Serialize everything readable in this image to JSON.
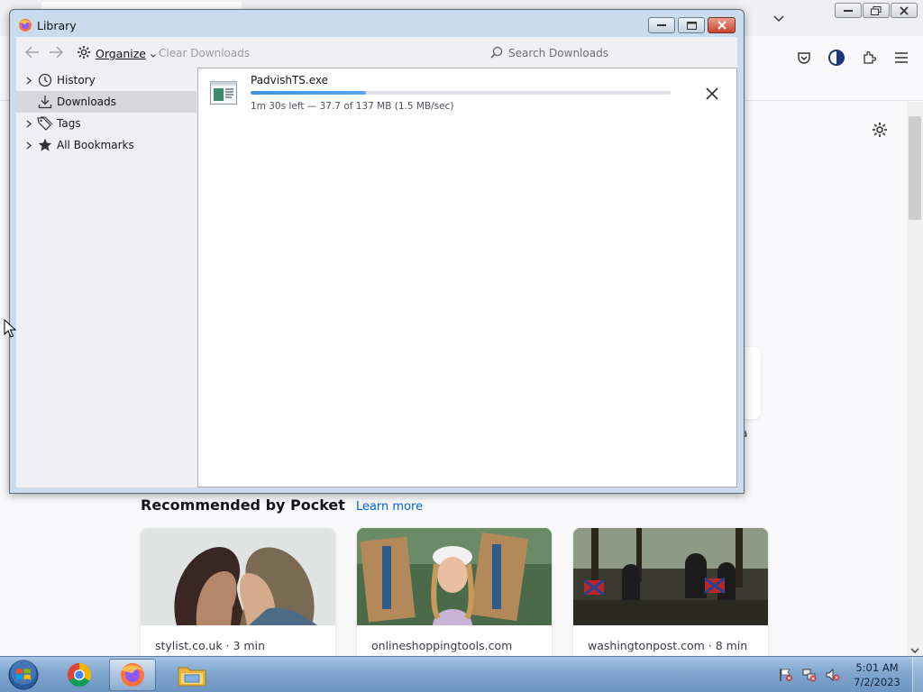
{
  "library": {
    "title": "Library",
    "toolbar": {
      "organize_label": "Organize",
      "clear_downloads_label": "Clear Downloads",
      "search_placeholder": "Search Downloads"
    },
    "sidebar": {
      "items": [
        {
          "label": "History",
          "icon": "clock-icon",
          "has_twisty": true,
          "selected": false
        },
        {
          "label": "Downloads",
          "icon": "download-icon",
          "has_twisty": false,
          "selected": true
        },
        {
          "label": "Tags",
          "icon": "tag-icon",
          "has_twisty": true,
          "selected": false
        },
        {
          "label": "All Bookmarks",
          "icon": "star-icon",
          "has_twisty": true,
          "selected": false
        }
      ]
    },
    "downloads": [
      {
        "filename": "PadvishTS.exe",
        "status": "1m 30s left — 37.7 of 137 MB (1.5 MB/sec)",
        "progress": 0.275
      }
    ]
  },
  "browser": {
    "pocket": {
      "title": "Recommended by Pocket",
      "learn_more": "Learn more",
      "cards": [
        {
          "source": "stylist.co.uk · 3 min"
        },
        {
          "source": "onlineshoppingtools.com"
        },
        {
          "source": "washingtonpost.com · 8 min"
        }
      ]
    },
    "ghost_text": "a"
  },
  "taskbar": {
    "time": "5:01 AM",
    "date": "7/2/2023",
    "apps": [
      "chrome-icon",
      "firefox-icon",
      "file-explorer-icon"
    ]
  },
  "colors": {
    "accent": "#0a84ff",
    "progress": "#3f92e0",
    "selected_row": "#d7d7db",
    "library_frame": "#c8dced",
    "taskbar": "#7fa6cf"
  }
}
